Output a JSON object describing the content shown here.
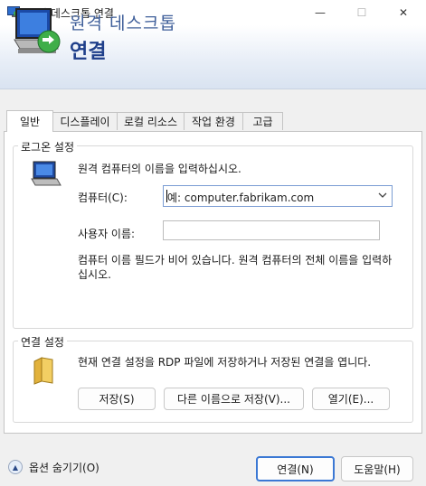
{
  "window": {
    "title": "원격 데스크톱 연결",
    "minimize": "—",
    "maximize": "☐",
    "close": "✕"
  },
  "banner": {
    "line1": "원격 데스크톱",
    "line2": "연결"
  },
  "tabs": [
    {
      "label": "일반",
      "active": true
    },
    {
      "label": "디스플레이"
    },
    {
      "label": "로컬 리소스"
    },
    {
      "label": "작업 환경"
    },
    {
      "label": "고급"
    }
  ],
  "logon": {
    "legend": "로그온 설정",
    "instruction": "원격 컴퓨터의 이름을 입력하십시오.",
    "computer_label": "컴퓨터(C):",
    "computer_placeholder": "예: computer.fabrikam.com",
    "dropdown_icon": "chevron-down",
    "user_label": "사용자 이름:",
    "user_value": "",
    "hint": "컴퓨터 이름 필드가 비어 있습니다. 원격 컴퓨터의 전체 이름을 입력하십시오."
  },
  "connection": {
    "legend": "연결 설정",
    "description": "현재 연결 설정을 RDP 파일에 저장하거나 저장된 연결을 엽니다.",
    "save": "저장(S)",
    "save_as": "다른 이름으로 저장(V)...",
    "open": "열기(E)..."
  },
  "footer": {
    "options": "옵션 숨기기(O)",
    "options_icon": "chevron-up",
    "connect": "연결(N)",
    "help": "도움말(H)"
  },
  "colors": {
    "accent": "#3b78d4",
    "banner_title": "#1f3f8a"
  }
}
